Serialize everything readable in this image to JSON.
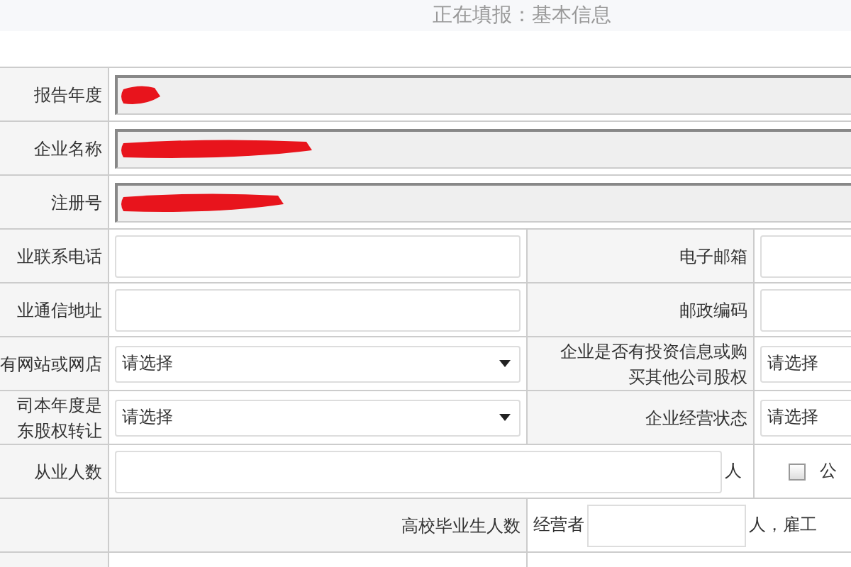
{
  "header": {
    "title": "正在填报：基本信息"
  },
  "rows": [
    {
      "kind": "wide",
      "label": "报告年度",
      "field": {
        "readonly": true,
        "redacted": true
      }
    },
    {
      "kind": "wide",
      "label": "企业名称",
      "field": {
        "readonly": true,
        "redacted": true
      }
    },
    {
      "kind": "wide",
      "label": "注册号",
      "field": {
        "readonly": true,
        "redacted": true
      }
    },
    {
      "kind": "pair",
      "left": {
        "lines": [
          "业联系电话"
        ],
        "field": {
          "kind": "text"
        }
      },
      "right": {
        "lines": [
          "电子邮箱"
        ],
        "field": {
          "kind": "text"
        }
      }
    },
    {
      "kind": "pair",
      "left": {
        "lines": [
          "业通信地址"
        ],
        "field": {
          "kind": "text"
        }
      },
      "right": {
        "lines": [
          "邮政编码"
        ],
        "field": {
          "kind": "text"
        }
      }
    },
    {
      "kind": "pair",
      "left": {
        "lines": [
          "有网站或网店"
        ],
        "field": {
          "kind": "select",
          "value": "请选择"
        }
      },
      "right": {
        "lines": [
          "企业是否有投资信息或购",
          "买其他公司股权"
        ],
        "field": {
          "kind": "select",
          "value": "请选择"
        }
      }
    },
    {
      "kind": "pair",
      "left": {
        "lines": [
          "司本年度是",
          "东股权转让"
        ],
        "field": {
          "kind": "select",
          "value": "请选择"
        }
      },
      "right": {
        "lines": [
          "企业经营状态"
        ],
        "field": {
          "kind": "select",
          "value": "请选择"
        }
      }
    },
    {
      "kind": "employees",
      "label": "从业人数",
      "unit": "人",
      "checkbox": {
        "checked": false,
        "label": "公"
      }
    },
    {
      "kind": "graduates",
      "label": "高校毕业生人数",
      "prefix": "经营者",
      "unit": "人，雇工"
    },
    {
      "kind": "blank"
    }
  ]
}
